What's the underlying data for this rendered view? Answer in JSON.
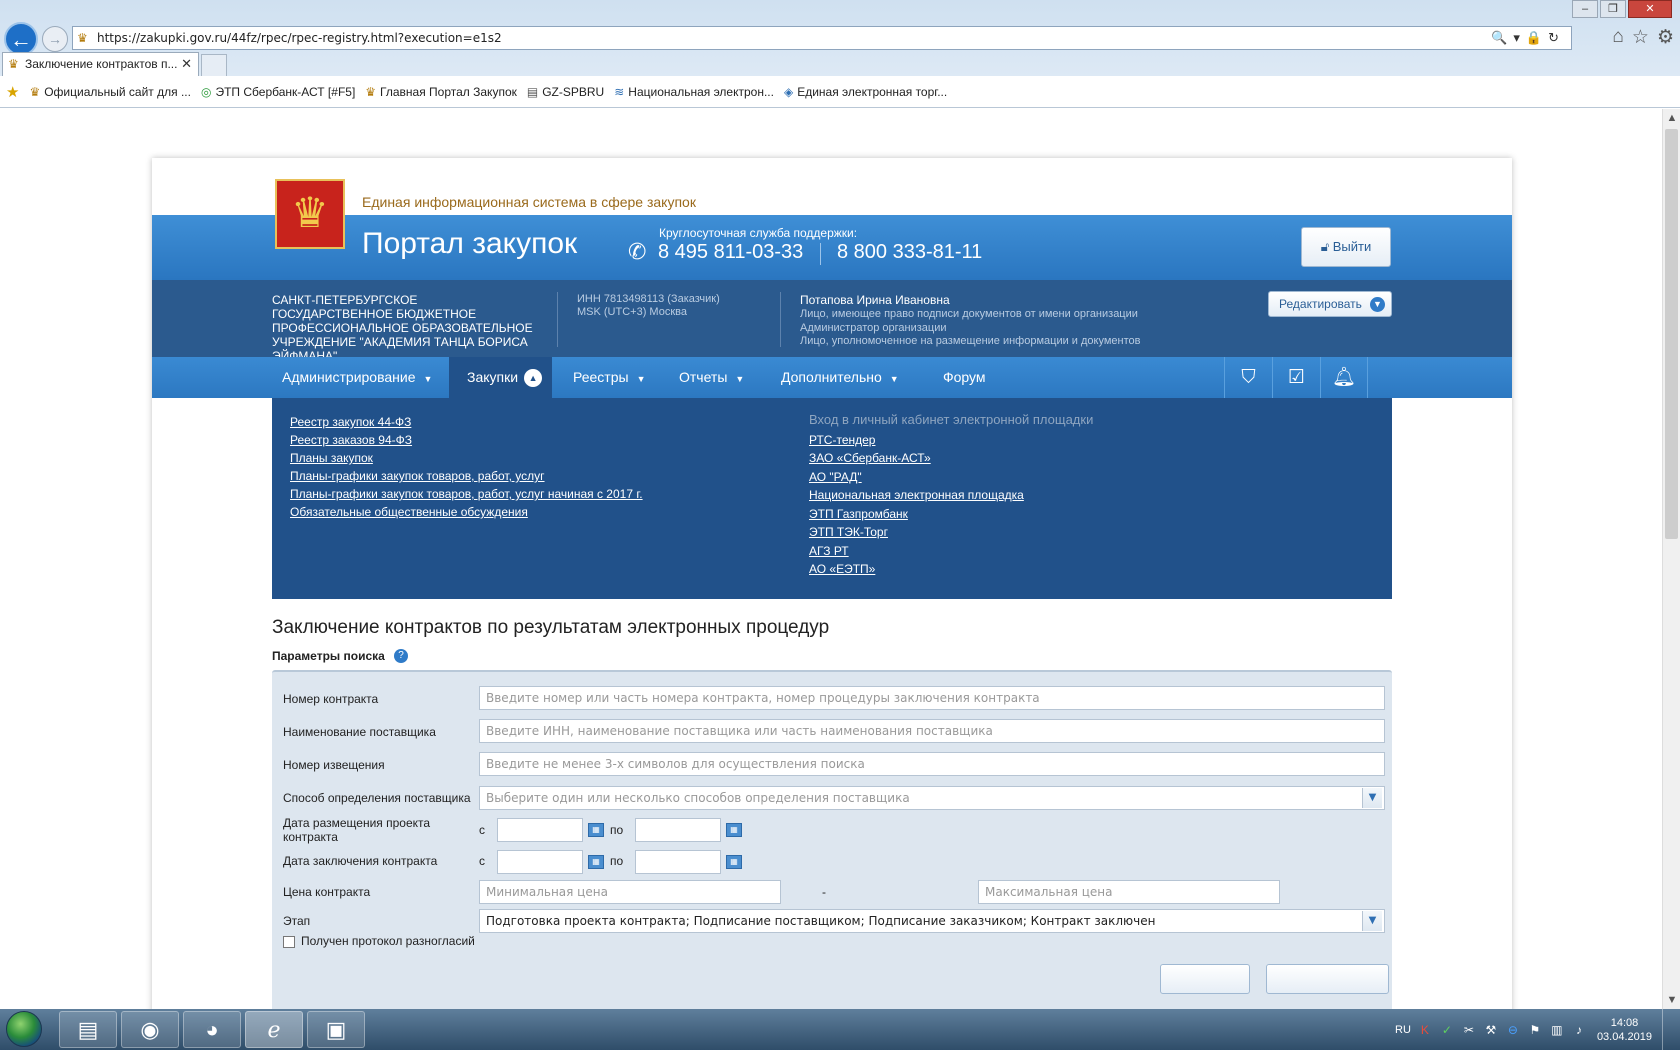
{
  "browser": {
    "url": "https://zakupki.gov.ru/44fz/rpec/rpec-registry.html?execution=e1s2",
    "tab_title": "Заключение контрактов п...",
    "tab_close": "✕",
    "nav_back": "←",
    "nav_forward": "→",
    "addr_icons": "🔍▾🔒↻",
    "tools_icons": [
      "⌂",
      "☆",
      "⚙"
    ],
    "favorites": [
      {
        "label": "Официальный сайт для ...",
        "icon": "emblem-icon"
      },
      {
        "label": "ЭТП Сбербанк-АСТ [#F5]",
        "icon": "sber-icon"
      },
      {
        "label": "Главная Портал Закупок",
        "icon": "emblem-icon"
      },
      {
        "label": "GZ-SPBRU",
        "icon": "page-icon"
      },
      {
        "label": "Национальная электрон...",
        "icon": "waves-icon"
      },
      {
        "label": "Единая электронная торг...",
        "icon": "diamond-icon"
      }
    ]
  },
  "header": {
    "subtitle": "Единая информационная система в сфере закупок",
    "title": "Портал закупок",
    "support_label": "Круглосуточная служба поддержки:",
    "phone_1": "8 495 811-03-33",
    "phone_2": "8 800 333-81-11",
    "logout": "Выйти"
  },
  "org": {
    "name": "САНКТ-ПЕТЕРБУРГСКОЕ ГОСУДАРСТВЕННОЕ БЮДЖЕТНОЕ ПРОФЕССИОНАЛЬНОЕ ОБРАЗОВАТЕЛЬНОЕ УЧРЕЖДЕНИЕ \"АКАДЕМИЯ ТАНЦА БОРИСА ЭЙФМАНА\"",
    "inn": "ИНН 7813498113 (Заказчик)",
    "timezone": "MSK (UTC+3) Москва",
    "user_name": "Потапова Ирина Ивановна",
    "roles": [
      "Лицо, имеющее право подписи документов от имени организации",
      "Администратор организации",
      "Лицо, уполномоченное на размещение информации и документов"
    ],
    "edit": "Редактировать"
  },
  "menu": [
    "Администрирование",
    "Закупки",
    "Реестры",
    "Отчеты",
    "Дополнительно",
    "Форум"
  ],
  "dropdown": {
    "left_links": [
      "Реестр закупок 44-ФЗ",
      "Реестр заказов 94-ФЗ",
      "Планы закупок",
      "Планы-графики закупок товаров, работ, услуг",
      "Планы-графики закупок товаров, работ, услуг начиная с 2017 г.",
      "Обязательные общественные обсуждения"
    ],
    "right_title": "Вход в личный кабинет электронной площадки",
    "right_links": [
      "РТС-тендер",
      "ЗАО «Сбербанк-АСТ»",
      "АО \"РАД\"",
      "Национальная электронная площадка",
      "ЭТП Газпромбанк",
      "ЭТП ТЭК-Торг",
      "АГЗ РТ",
      "АО «ЕЭТП»"
    ]
  },
  "main": {
    "title": "Заключение контрактов по результатам электронных процедур",
    "params_label": "Параметры поиска",
    "help": "?"
  },
  "form": {
    "contract_number_label": "Номер контракта",
    "contract_number_placeholder": "Введите номер или часть номера контракта, номер процедуры заключения контракта",
    "supplier_label": "Наименование поставщика",
    "supplier_placeholder": "Введите ИНН, наименование поставщика или часть наименования поставщика",
    "notice_label": "Номер извещения",
    "notice_placeholder": "Введите не менее 3-х символов для осуществления поиска",
    "method_label": "Способ определения поставщика",
    "method_placeholder": "Выберите один или несколько способов определения поставщика",
    "date_posted_label": "Дата размещения проекта контракта",
    "date_concluded_label": "Дата заключения контракта",
    "from": "с",
    "to": "по",
    "price_label": "Цена контракта",
    "price_min_placeholder": "Минимальная цена",
    "price_dash": "-",
    "price_max_placeholder": "Максимальная цена",
    "stage_label": "Этап",
    "stage_value": "Подготовка проекта контракта; Подписание поставщиком; Подписание заказчиком; Контракт заключен",
    "disagreement_label": "Получен протокол разногласий"
  },
  "taskbar": {
    "lang": "RU",
    "time": "14:08",
    "date": "03.04.2019",
    "apps": [
      "explorer",
      "chrome",
      "firefox",
      "internet-explorer",
      "app"
    ]
  },
  "colors": {
    "header_blue": "#2a76c0",
    "org_band": "#2b5a8e",
    "dropdown_bg": "#21518a",
    "form_bg": "#dde6ef",
    "subtitle_gold": "#9a6a1c"
  }
}
